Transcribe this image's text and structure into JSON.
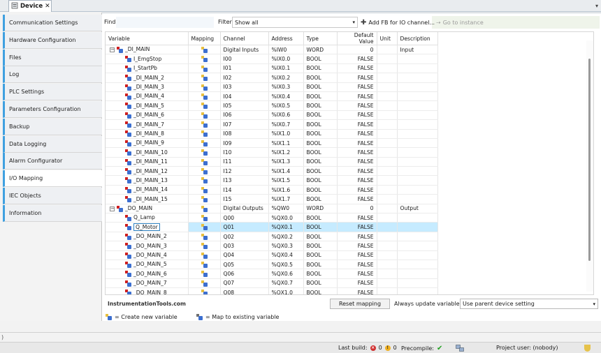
{
  "document_tab": {
    "label": "Device",
    "close": "✕"
  },
  "sidebar": {
    "items": [
      {
        "label": "Communication Settings"
      },
      {
        "label": "Hardware Configuration"
      },
      {
        "label": "Files"
      },
      {
        "label": "Log"
      },
      {
        "label": "PLC Settings"
      },
      {
        "label": "Parameters Configuration"
      },
      {
        "label": "Backup"
      },
      {
        "label": "Data Logging"
      },
      {
        "label": "Alarm Configurator"
      },
      {
        "label": "I/O Mapping"
      },
      {
        "label": "IEC Objects"
      },
      {
        "label": "Information"
      }
    ],
    "active_index": 9
  },
  "toolbar": {
    "find_label": "Find",
    "find_value": "",
    "filter_label": "Filter",
    "filter_value": "Show all",
    "add_fb_label": "Add FB for IO channel...",
    "goto_label": "Go to instance"
  },
  "table": {
    "headers": [
      "Variable",
      "Mapping",
      "Channel",
      "Address",
      "Type",
      "Default Value",
      "Unit",
      "Description"
    ],
    "rows": [
      {
        "variable": "_DI_MAIN",
        "group": true,
        "channel": "Digital Inputs",
        "address": "%IW0",
        "type": "WORD",
        "default": "0",
        "unit": "",
        "description": "Input"
      },
      {
        "variable": "I_EmgStop",
        "channel": "I00",
        "address": "%IX0.0",
        "type": "BOOL",
        "default": "FALSE",
        "unit": "",
        "description": ""
      },
      {
        "variable": "I_StartPb",
        "channel": "I01",
        "address": "%IX0.1",
        "type": "BOOL",
        "default": "FALSE",
        "unit": "",
        "description": ""
      },
      {
        "variable": "_DI_MAIN_2",
        "channel": "I02",
        "address": "%IX0.2",
        "type": "BOOL",
        "default": "FALSE",
        "unit": "",
        "description": ""
      },
      {
        "variable": "_DI_MAIN_3",
        "channel": "I03",
        "address": "%IX0.3",
        "type": "BOOL",
        "default": "FALSE",
        "unit": "",
        "description": ""
      },
      {
        "variable": "_DI_MAIN_4",
        "channel": "I04",
        "address": "%IX0.4",
        "type": "BOOL",
        "default": "FALSE",
        "unit": "",
        "description": ""
      },
      {
        "variable": "_DI_MAIN_5",
        "channel": "I05",
        "address": "%IX0.5",
        "type": "BOOL",
        "default": "FALSE",
        "unit": "",
        "description": ""
      },
      {
        "variable": "_DI_MAIN_6",
        "channel": "I06",
        "address": "%IX0.6",
        "type": "BOOL",
        "default": "FALSE",
        "unit": "",
        "description": ""
      },
      {
        "variable": "_DI_MAIN_7",
        "channel": "I07",
        "address": "%IX0.7",
        "type": "BOOL",
        "default": "FALSE",
        "unit": "",
        "description": ""
      },
      {
        "variable": "_DI_MAIN_8",
        "channel": "I08",
        "address": "%IX1.0",
        "type": "BOOL",
        "default": "FALSE",
        "unit": "",
        "description": ""
      },
      {
        "variable": "_DI_MAIN_9",
        "channel": "I09",
        "address": "%IX1.1",
        "type": "BOOL",
        "default": "FALSE",
        "unit": "",
        "description": ""
      },
      {
        "variable": "_DI_MAIN_10",
        "channel": "I10",
        "address": "%IX1.2",
        "type": "BOOL",
        "default": "FALSE",
        "unit": "",
        "description": ""
      },
      {
        "variable": "_DI_MAIN_11",
        "channel": "I11",
        "address": "%IX1.3",
        "type": "BOOL",
        "default": "FALSE",
        "unit": "",
        "description": ""
      },
      {
        "variable": "_DI_MAIN_12",
        "channel": "I12",
        "address": "%IX1.4",
        "type": "BOOL",
        "default": "FALSE",
        "unit": "",
        "description": ""
      },
      {
        "variable": "_DI_MAIN_13",
        "channel": "I13",
        "address": "%IX1.5",
        "type": "BOOL",
        "default": "FALSE",
        "unit": "",
        "description": ""
      },
      {
        "variable": "_DI_MAIN_14",
        "channel": "I14",
        "address": "%IX1.6",
        "type": "BOOL",
        "default": "FALSE",
        "unit": "",
        "description": ""
      },
      {
        "variable": "_DI_MAIN_15",
        "channel": "I15",
        "address": "%IX1.7",
        "type": "BOOL",
        "default": "FALSE",
        "unit": "",
        "description": ""
      },
      {
        "variable": "_DO_MAIN",
        "group": true,
        "channel": "Digital Outputs",
        "address": "%QW0",
        "type": "WORD",
        "default": "0",
        "unit": "",
        "description": "Output"
      },
      {
        "variable": "Q_Lamp",
        "channel": "Q00",
        "address": "%QX0.0",
        "type": "BOOL",
        "default": "FALSE",
        "unit": "",
        "description": ""
      },
      {
        "variable": "Q_Motor",
        "selected": true,
        "channel": "Q01",
        "address": "%QX0.1",
        "type": "BOOL",
        "default": "FALSE",
        "unit": "",
        "description": ""
      },
      {
        "variable": "_DO_MAIN_2",
        "channel": "Q02",
        "address": "%QX0.2",
        "type": "BOOL",
        "default": "FALSE",
        "unit": "",
        "description": ""
      },
      {
        "variable": "_DO_MAIN_3",
        "channel": "Q03",
        "address": "%QX0.3",
        "type": "BOOL",
        "default": "FALSE",
        "unit": "",
        "description": ""
      },
      {
        "variable": "_DO_MAIN_4",
        "channel": "Q04",
        "address": "%QX0.4",
        "type": "BOOL",
        "default": "FALSE",
        "unit": "",
        "description": ""
      },
      {
        "variable": "_DO_MAIN_5",
        "channel": "Q05",
        "address": "%QX0.5",
        "type": "BOOL",
        "default": "FALSE",
        "unit": "",
        "description": ""
      },
      {
        "variable": "_DO_MAIN_6",
        "channel": "Q06",
        "address": "%QX0.6",
        "type": "BOOL",
        "default": "FALSE",
        "unit": "",
        "description": ""
      },
      {
        "variable": "_DO_MAIN_7",
        "channel": "Q07",
        "address": "%QX0.7",
        "type": "BOOL",
        "default": "FALSE",
        "unit": "",
        "description": ""
      },
      {
        "variable": "_DO_MAIN_8",
        "channel": "Q08",
        "address": "%QX1.0",
        "type": "BOOL",
        "default": "FALSE",
        "unit": "",
        "description": ""
      }
    ]
  },
  "bottom": {
    "watermark": "InstrumentationTools.com",
    "reset_label": "Reset mapping",
    "always_label": "Always update variables:",
    "always_value": "Use parent device setting"
  },
  "legend": {
    "create": "= Create new variable",
    "map": "= Map to existing variable"
  },
  "status": {
    "left_glyph": ")",
    "last_build_label": "Last build:",
    "errors": "0",
    "warnings": "0",
    "precompile_label": "Precompile:",
    "project_user": "Project user: (nobody)"
  },
  "colors": {
    "accent": "#3fa0e0",
    "selection": "#c6ebff"
  }
}
